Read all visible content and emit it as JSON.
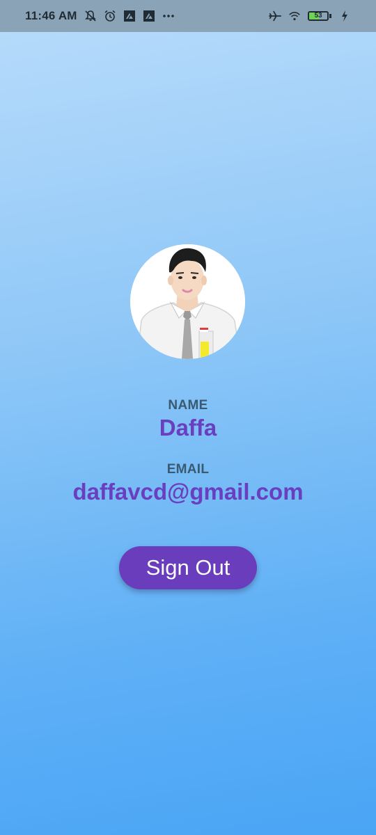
{
  "status_bar": {
    "time": "11:46 AM",
    "icons_left": [
      "notifications-off-icon",
      "alarm-icon",
      "app-icon",
      "app-icon",
      "more-icon"
    ],
    "icons_right": [
      "airplane-mode-icon",
      "wifi-icon",
      "battery-icon",
      "charging-icon"
    ],
    "battery_level": "53",
    "battery_percent": 53
  },
  "profile": {
    "name_label": "NAME",
    "name": "Daffa",
    "email_label": "EMAIL",
    "email": "daffavcd@gmail.com"
  },
  "actions": {
    "sign_out_label": "Sign Out"
  },
  "colors": {
    "status_bar_bg": "#8aa3b6",
    "value_text": "#6a3fbf",
    "label_text": "#3a5a72",
    "button_bg": "#6a3dbd",
    "button_text": "#ffffff"
  }
}
